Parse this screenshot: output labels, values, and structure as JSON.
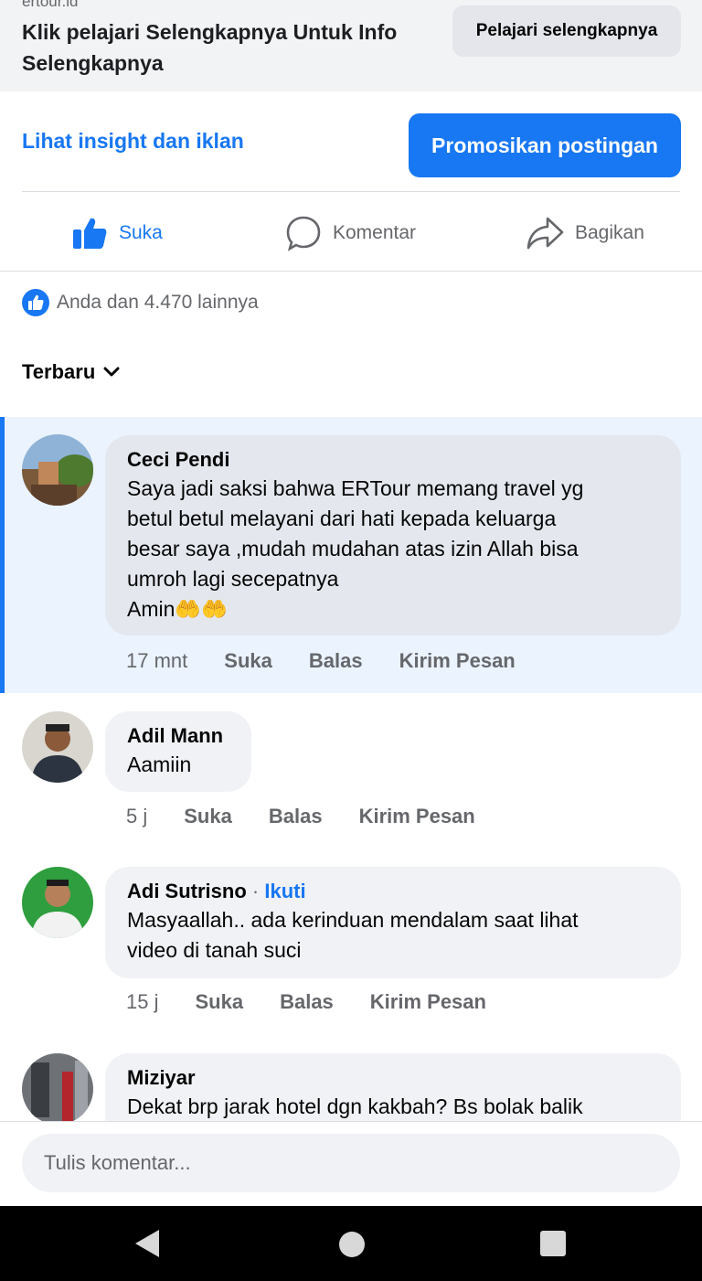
{
  "ad": {
    "domain": "ertour.id",
    "text": "Klik pelajari Selengkapnya Untuk Info Selengkapnya",
    "button_label": "Pelajari selengkapnya"
  },
  "insight": {
    "link_label": "Lihat insight dan iklan",
    "promote_label": "Promosikan postingan"
  },
  "actions": {
    "like": "Suka",
    "comment": "Komentar",
    "share": "Bagikan"
  },
  "reactions": {
    "summary": "Anda dan 4.470 lainnya"
  },
  "sort": {
    "label": "Terbaru"
  },
  "comments": [
    {
      "name": "Ceci Pendi",
      "text": "Saya jadi saksi bahwa ERTour memang travel yg\nbetul betul melayani dari hati  kepada keluarga\nbesar saya ,mudah mudahan atas izin Allah bisa\numroh lagi secepatnya\nAmin🤲🤲",
      "time": "17 mnt",
      "like": "Suka",
      "reply": "Balas",
      "message": "Kirim Pesan"
    },
    {
      "name": "Adil Mann",
      "text": "Aamiin",
      "time": "5 j",
      "like": "Suka",
      "reply": "Balas",
      "message": "Kirim Pesan"
    },
    {
      "name": "Adi Sutrisno",
      "follow_sep": "·",
      "follow": "Ikuti",
      "text": "Masyaallah.. ada kerinduan mendalam saat lihat\nvideo di tanah suci",
      "time": "15 j",
      "like": "Suka",
      "reply": "Balas",
      "message": "Kirim Pesan"
    },
    {
      "name": "Miziyar",
      "text": "Dekat brp jarak hotel dgn kakbah? Bs bolak balik"
    }
  ],
  "composer": {
    "placeholder": "Tulis komentar..."
  },
  "colors": {
    "accent": "#1877f2",
    "bubble": "#f0f2f5",
    "highlight": "#ebf3fe"
  },
  "icons": [
    "thumbs-up-icon",
    "comment-icon",
    "share-icon",
    "like-badge-icon",
    "chevron-down-icon",
    "back-icon",
    "home-icon",
    "recents-icon"
  ]
}
